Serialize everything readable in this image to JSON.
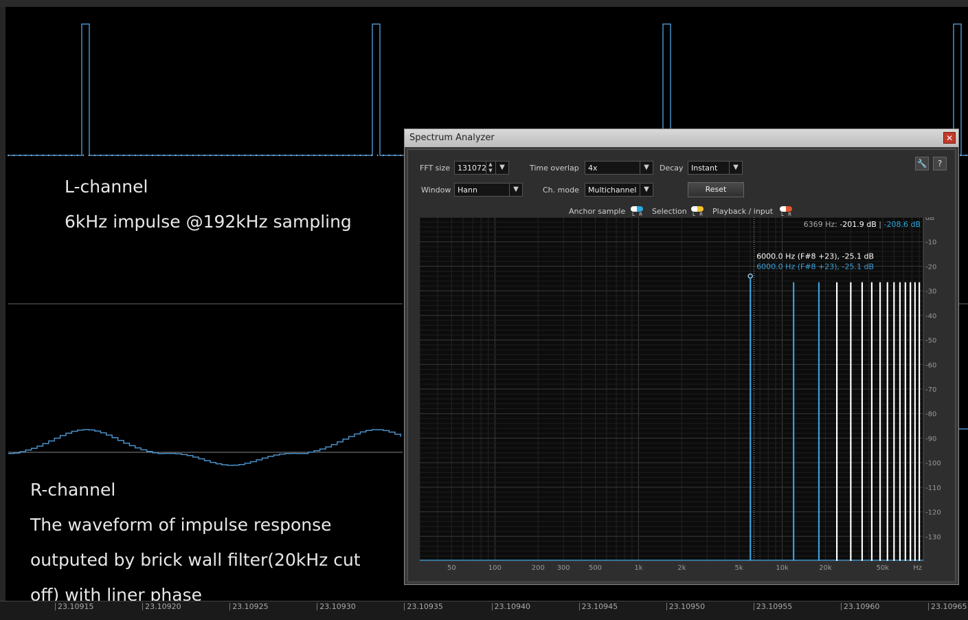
{
  "annotations": {
    "l_title": "L-channel",
    "l_desc": "6kHz impulse @192kHz sampling",
    "r_title": "R-channel",
    "r_line1": "The waveform of impulse response",
    "r_line2": "outputed by brick wall filter(20kHz cut",
    "r_line3": "off) with liner phase"
  },
  "timeline": {
    "labels": [
      "23.10915",
      "23.10920",
      "23.10925",
      "23.10930",
      "23.10935",
      "23.10940",
      "23.10945",
      "23.10950",
      "23.10955",
      "23.10960",
      "23.10965"
    ]
  },
  "spectrum_analyzer": {
    "title": "Spectrum Analyzer",
    "close_icon": "close-icon",
    "settings_icon": "wrench-icon",
    "help_label": "?",
    "fft_size_label": "FFT size",
    "fft_size_value": "131072",
    "time_overlap_label": "Time overlap",
    "time_overlap_value": "4x",
    "decay_label": "Decay",
    "decay_value": "Instant",
    "window_label": "Window",
    "window_value": "Hann",
    "ch_mode_label": "Ch. mode",
    "ch_mode_value": "Multichannel",
    "reset_label": "Reset",
    "legend": {
      "anchor": "Anchor sample",
      "selection": "Selection",
      "playback": "Playback / input",
      "lr": "L R"
    },
    "colors": {
      "anchor": "#2aa8e0",
      "selection": "#f2c230",
      "playback": "#e0552a",
      "left_series": "#ffffff",
      "right_series": "#3aa0d8"
    },
    "readout": {
      "freq": "6369 Hz:",
      "left_db": "-201.9 dB",
      "sep": "|",
      "right_db": "-208.6 dB"
    },
    "marker": {
      "left": "6000.0 Hz (F#8 +23), -25.1 dB",
      "right": "6000.0 Hz (F#8 +23), -25.1 dB"
    }
  },
  "chart_data": {
    "type": "bar",
    "x_scale": "log",
    "xlim": [
      30,
      96000
    ],
    "ylim": [
      -140,
      0
    ],
    "grid": true,
    "x_ticks": [
      50,
      100,
      200,
      300,
      500,
      1000,
      2000,
      5000,
      10000,
      20000,
      50000
    ],
    "x_tick_labels": [
      "50",
      "100",
      "200",
      "300",
      "500",
      "1k",
      "2k",
      "5k",
      "10k",
      "20k",
      "50k"
    ],
    "x_unit": "Hz",
    "y_ticks": [
      0,
      -10,
      -20,
      -30,
      -40,
      -50,
      -60,
      -70,
      -80,
      -90,
      -100,
      -110,
      -120,
      -130
    ],
    "y_tick_labels": [
      "dB",
      "-10",
      "-20",
      "-30",
      "-40",
      "-50",
      "-60",
      "-70",
      "-80",
      "-90",
      "-100",
      "-110",
      "-120",
      "-130"
    ],
    "series": [
      {
        "color": "#3aa0d8",
        "x": [
          6000,
          12000,
          18000
        ],
        "y": [
          -25.1,
          -26.5,
          -26.5
        ]
      },
      {
        "color": "#ffffff",
        "x": [
          24000,
          30000,
          36000,
          42000,
          48000,
          54000,
          60000,
          66000,
          72000,
          78000,
          84000,
          90000
        ],
        "y": [
          -26.5,
          -26.5,
          -26.5,
          -26.5,
          -26.5,
          -26.5,
          -26.5,
          -26.5,
          -26.5,
          -26.5,
          -26.5,
          -26.5
        ]
      }
    ]
  }
}
